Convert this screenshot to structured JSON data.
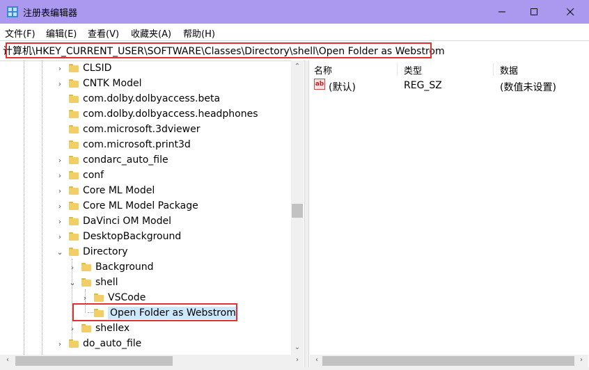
{
  "window": {
    "title": "注册表编辑器"
  },
  "menu": {
    "file": "文件(F)",
    "edit": "编辑(E)",
    "view": "查看(V)",
    "favorites": "收藏夹(A)",
    "help": "帮助(H)"
  },
  "address": {
    "path": "计算机\\HKEY_CURRENT_USER\\SOFTWARE\\Classes\\Directory\\shell\\Open Folder as Webstrom"
  },
  "tree": {
    "items": [
      {
        "label": "CLSID",
        "expander": "›"
      },
      {
        "label": "CNTK Model",
        "expander": "›"
      },
      {
        "label": "com.dolby.dolbyaccess.beta",
        "expander": ""
      },
      {
        "label": "com.dolby.dolbyaccess.headphones",
        "expander": ""
      },
      {
        "label": "com.microsoft.3dviewer",
        "expander": ""
      },
      {
        "label": "com.microsoft.print3d",
        "expander": ""
      },
      {
        "label": "condarc_auto_file",
        "expander": "›"
      },
      {
        "label": "conf",
        "expander": "›"
      },
      {
        "label": "Core ML Model",
        "expander": "›"
      },
      {
        "label": "Core ML Model Package",
        "expander": "›"
      },
      {
        "label": "DaVinci OM Model",
        "expander": "›"
      },
      {
        "label": "DesktopBackground",
        "expander": "›"
      },
      {
        "label": "Directory",
        "expander": "⌄"
      },
      {
        "label": "Background",
        "expander": "›"
      },
      {
        "label": "shell",
        "expander": "⌄"
      },
      {
        "label": "VSCode",
        "expander": "›"
      },
      {
        "label": "Open Folder as Webstrom",
        "expander": ""
      },
      {
        "label": "shellex",
        "expander": "›"
      },
      {
        "label": "do_auto_file",
        "expander": "›"
      }
    ]
  },
  "list": {
    "headers": {
      "name": "名称",
      "type": "类型",
      "data": "数据"
    },
    "rows": [
      {
        "name": "(默认)",
        "type": "REG_SZ",
        "data": "(数值未设置)"
      }
    ]
  },
  "colors": {
    "titlebar": "#aa99ee",
    "highlight": "#e03030",
    "selection": "#cce8ff"
  }
}
